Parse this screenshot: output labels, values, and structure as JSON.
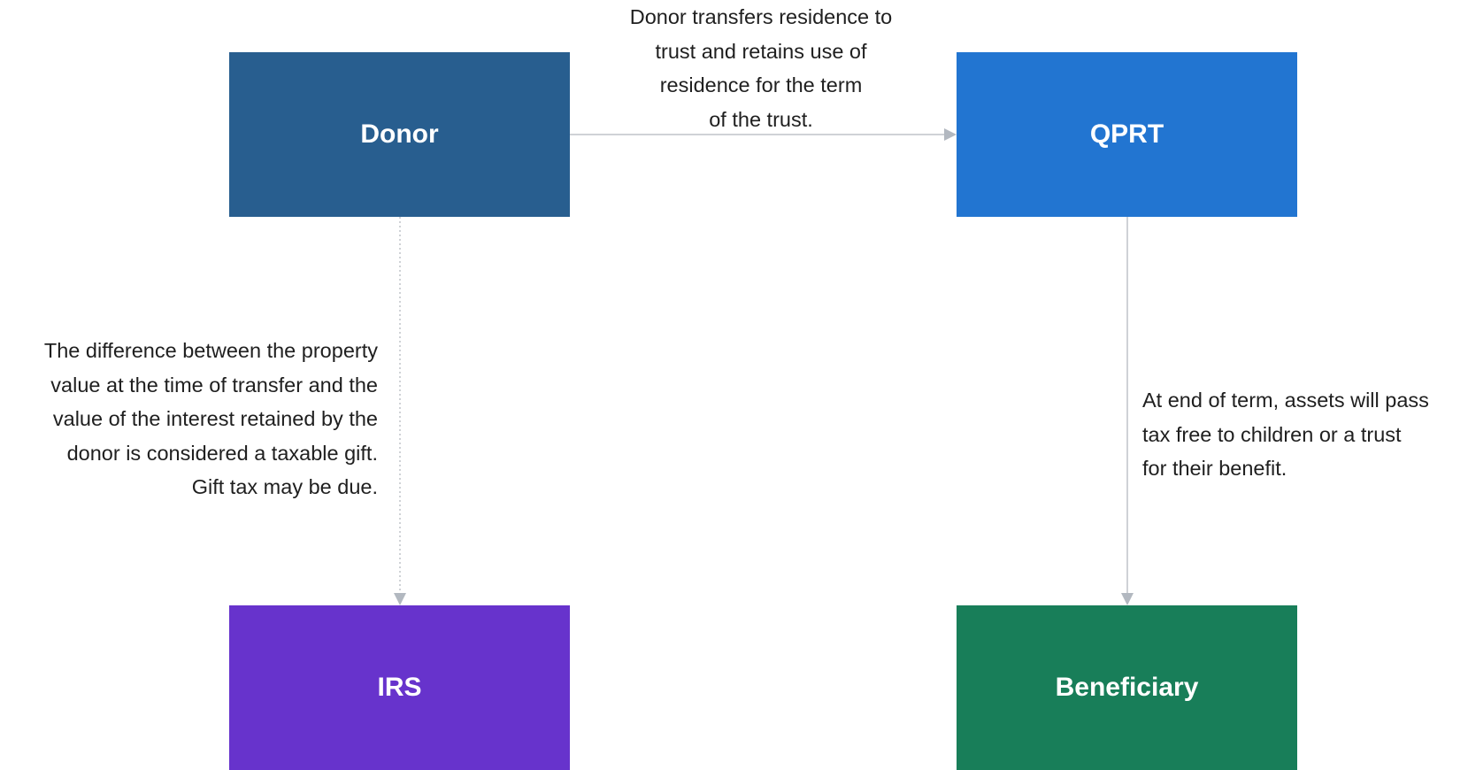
{
  "colors": {
    "donor": "#285E8F",
    "qprt": "#2275D1",
    "irs": "#6733CC",
    "beneficiary": "#187E59",
    "connector": "#BFC3C9",
    "arrowhead": "#B2B8C0",
    "text": "#1F1F1F"
  },
  "nodes": {
    "donor": {
      "label": "Donor"
    },
    "qprt": {
      "label": "QPRT"
    },
    "irs": {
      "label": "IRS"
    },
    "beneficiary": {
      "label": "Beneficiary"
    }
  },
  "edges": [
    {
      "from": "donor",
      "to": "qprt",
      "style": "solid",
      "label": "Donor transfers residence to\ntrust and retains use of\nresidence for the term\nof the trust."
    },
    {
      "from": "donor",
      "to": "irs",
      "style": "dotted",
      "label": "The difference between the property\nvalue at the time of transfer and the\nvalue of the interest retained by the\ndonor is considered a taxable gift.\nGift tax may be due."
    },
    {
      "from": "qprt",
      "to": "beneficiary",
      "style": "solid",
      "label": "At end of term, assets will pass\ntax free to children or a trust\nfor their benefit."
    }
  ]
}
